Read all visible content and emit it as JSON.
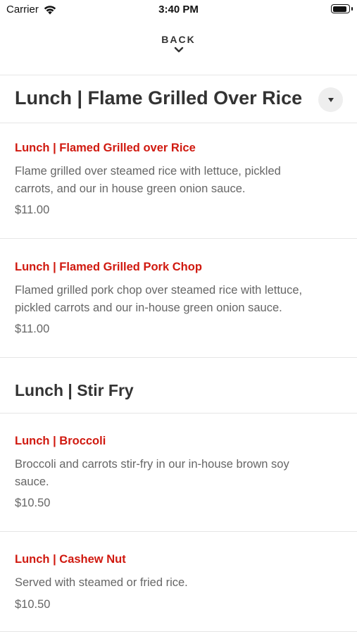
{
  "status_bar": {
    "carrier": "Carrier",
    "time": "3:40 PM",
    "battery_level": 0.9
  },
  "nav": {
    "back_label": "BACK",
    "back_icon": "chevron-down-icon"
  },
  "sections": [
    {
      "title": "Lunch | Flame Grilled Over Rice",
      "items": [
        {
          "name": "Lunch | Flamed Grilled over Rice",
          "description_lines": [
            "Flame grilled over steamed rice with lettuce, pickled",
            "carrots, and our in house green onion sauce."
          ],
          "price": "$11.00"
        },
        {
          "name": "Lunch | Flamed Grilled Pork Chop",
          "description_lines": [
            "Flamed grilled pork chop over steamed rice with lettuce,",
            "pickled carrots and our in-house green onion sauce."
          ],
          "price": "$11.00"
        }
      ]
    },
    {
      "title": "Lunch | Stir Fry",
      "items": [
        {
          "name": "Lunch | Broccoli",
          "description_lines": [
            "Broccoli and carrots stir-fry in our in-house brown soy",
            "sauce."
          ],
          "price": "$10.50"
        },
        {
          "name": "Lunch | Cashew Nut",
          "description_lines": [
            "Served with steamed or fried rice."
          ],
          "price": "$10.50"
        }
      ]
    }
  ],
  "colors": {
    "item_title": "#d0190f",
    "text_muted": "#666666",
    "heading": "#333333",
    "divider": "#e6e6e6"
  }
}
